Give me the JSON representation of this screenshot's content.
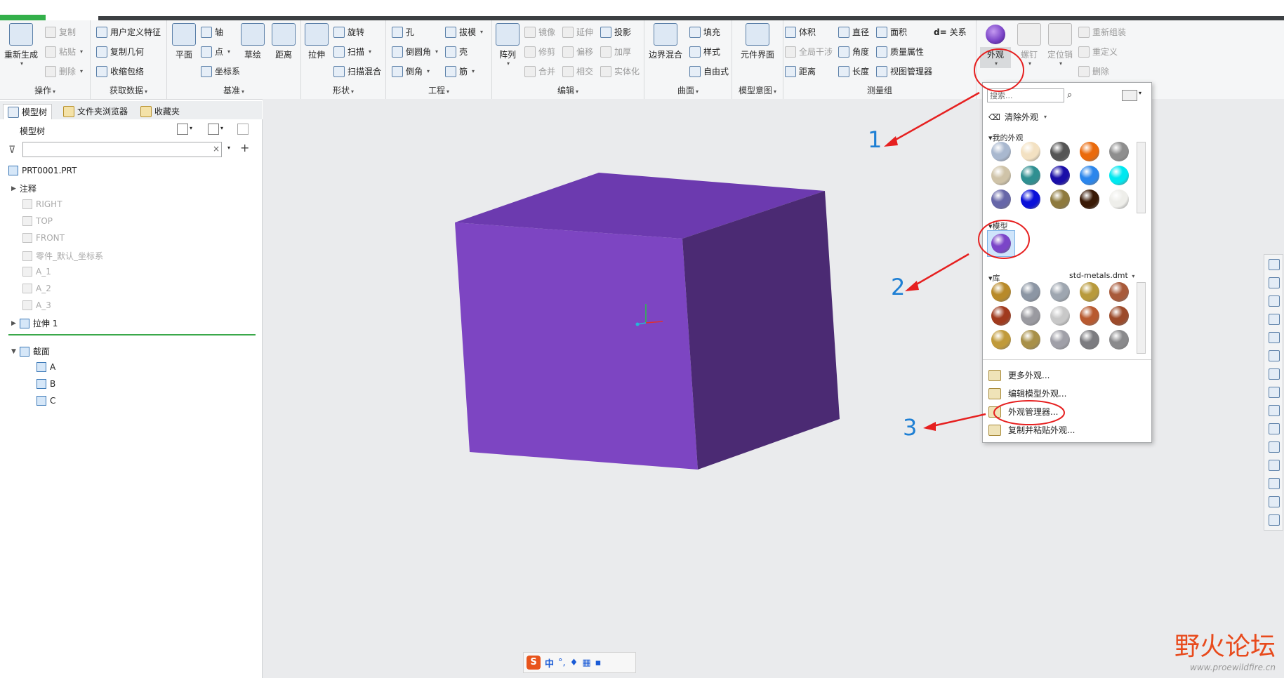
{
  "ribbon": {
    "groups": [
      {
        "label": "操作",
        "big": "重新生成",
        "items": [
          "复制",
          "粘贴",
          "删除"
        ]
      },
      {
        "label": "获取数据",
        "items": [
          "用户定义特征",
          "复制几何",
          "收缩包络"
        ]
      },
      {
        "label": "基准",
        "big_items": [
          "平面",
          "草绘",
          "距离"
        ],
        "items": [
          "轴",
          "点",
          "坐标系"
        ]
      },
      {
        "label": "形状",
        "big": "拉伸",
        "items": [
          "旋转",
          "扫描",
          "扫描混合"
        ]
      },
      {
        "label": "工程",
        "items": [
          "孔",
          "拔模",
          "倒圆角",
          "壳",
          "倒角",
          "筋"
        ]
      },
      {
        "label": "编辑",
        "big": "阵列",
        "items": [
          "镜像",
          "延伸",
          "投影",
          "修剪",
          "偏移",
          "加厚",
          "合并",
          "相交",
          "实体化"
        ]
      },
      {
        "label": "曲面",
        "big": "边界混合",
        "items": [
          "填充",
          "样式",
          "自由式"
        ]
      },
      {
        "label": "模型意图",
        "big": "元件界面"
      },
      {
        "label": "测量组",
        "items": [
          "体积",
          "直径",
          "面积",
          "关系",
          "全局干涉",
          "角度",
          "质量属性",
          "距离",
          "长度",
          "视图管理器"
        ]
      },
      {
        "big_items": [
          "外观",
          "螺钉",
          "定位销"
        ],
        "items": [
          "重新组装",
          "重定义",
          "删除"
        ]
      }
    ],
    "relation_prefix": "d="
  },
  "tabs": [
    "模型树",
    "文件夹浏览器",
    "收藏夹"
  ],
  "tree": {
    "header": "模型树",
    "filter_placeholder": "",
    "root": "PRT0001.PRT",
    "items": [
      {
        "label": "注释",
        "dim": false
      },
      {
        "label": "RIGHT",
        "dim": true
      },
      {
        "label": "TOP",
        "dim": true
      },
      {
        "label": "FRONT",
        "dim": true
      },
      {
        "label": "零件_默认_坐标系",
        "dim": true
      },
      {
        "label": "A_1",
        "dim": true
      },
      {
        "label": "A_2",
        "dim": true
      },
      {
        "label": "A_3",
        "dim": true
      },
      {
        "label": "拉伸 1",
        "dim": false
      }
    ],
    "section": {
      "label": "截面",
      "children": [
        "A",
        "B",
        "C"
      ]
    }
  },
  "popup": {
    "search_placeholder": "搜索...",
    "clear": "清除外观",
    "my_appearances": "我的外观",
    "model": "模型",
    "library": "库",
    "library_file": "std-metals.dmt",
    "my_colors": [
      "#a9b8cf",
      "#f3e1c2",
      "#555555",
      "#ea6a0c",
      "#8e8e8e",
      "#cfc3a8",
      "#2f8f91",
      "#1a0ea8",
      "#2b86ec",
      "#00e8f0",
      "#6666a8",
      "#0a10d8",
      "#8e7a3e",
      "#3a1a06",
      "#eeeeea"
    ],
    "model_color": "#7b45c8",
    "metal_colors": [
      "#b88a2a",
      "#8c96a4",
      "#9ea6b0",
      "#b89a3c",
      "#a85a3a",
      "#a03a1e",
      "#9a9aa0",
      "#c8c8c8",
      "#b85a30",
      "#9c4a2a",
      "#c09a3a",
      "#a89048",
      "#a0a0a8",
      "#7c7c80",
      "#8a8a8c"
    ],
    "menu": [
      "更多外观...",
      "编辑模型外观...",
      "外观管理器...",
      "复制并粘贴外观..."
    ]
  },
  "annotations": [
    "1",
    "2",
    "3"
  ],
  "cube_colors": {
    "front": "#7d45c2",
    "top": "#6c3aaf",
    "side": "#4b2a73"
  },
  "ime": {
    "icon": "S",
    "mode": "中"
  },
  "watermark": {
    "brand": "野火论坛",
    "url": "www.proewildfire.cn"
  }
}
